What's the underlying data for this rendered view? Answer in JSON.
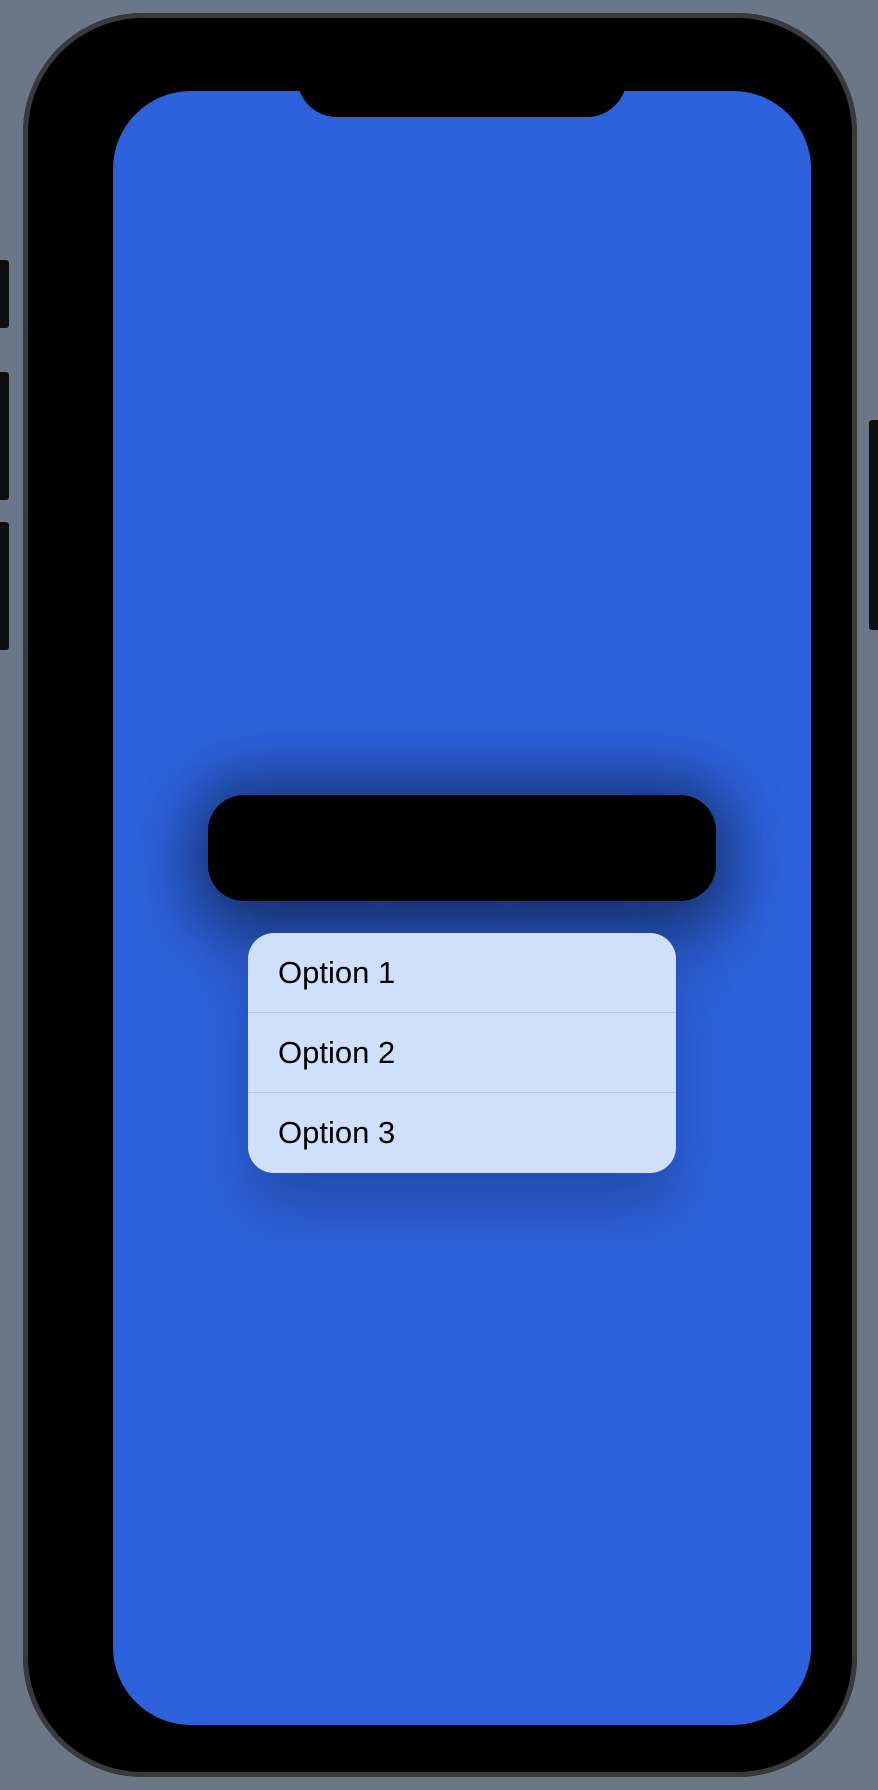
{
  "colors": {
    "screen_background": "#2d62dc",
    "menu_background": "#cfe0fa",
    "trigger_background": "#000000"
  },
  "menu": {
    "items": [
      {
        "label": "Option 1"
      },
      {
        "label": "Option 2"
      },
      {
        "label": "Option 3"
      }
    ]
  }
}
